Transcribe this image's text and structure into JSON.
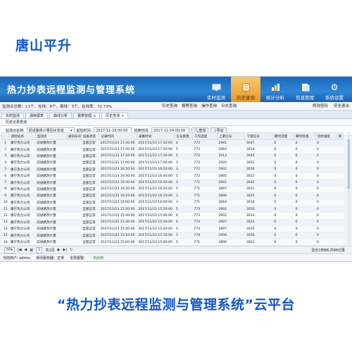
{
  "brand": "唐山平升",
  "caption": "“热力抄表远程监测与管理系统”云平台",
  "app": {
    "title": "热力抄表远程监测与管理系统",
    "nav": [
      {
        "label": "实时监测",
        "icon": "monitor-icon"
      },
      {
        "label": "历史查询",
        "icon": "history-icon"
      },
      {
        "label": "统计分析",
        "icon": "chart-icon"
      },
      {
        "label": "信息管理",
        "icon": "document-icon"
      },
      {
        "label": "系统设置",
        "icon": "gear-icon"
      }
    ]
  },
  "status": {
    "summary": "监测点总数：11个，在线：8个，离线：3个，在线率：72.73%",
    "sub_actions": [
      "历史查询",
      "报警查询",
      "操作查询",
      "日志查询"
    ],
    "right_actions": [
      "修改密码",
      "安全退出"
    ]
  },
  "tabs": [
    "实时监测",
    "通用报表",
    "曲线分析",
    "报表管理",
    "历史查询"
  ],
  "panel_title": "历史记录查询",
  "query": {
    "point_label": "监测点名称:",
    "point_value": "前进路热计量回水管道",
    "start_label": "起始时间:",
    "start_value": "2017-11-23 00:00",
    "end_label": "结束时间:",
    "end_value": "2017-11-24 00:00",
    "search_label": "查询",
    "export_label": "导出"
  },
  "table": {
    "headers": [
      "",
      "测控站点",
      "监测点",
      "通讯员ID",
      "设备状态",
      "记录时间",
      "采集时间",
      "信号质量",
      "工作温度",
      "上游信号",
      "下游信号",
      "瞬时流量",
      "瞬时热量",
      "流体速度",
      "累"
    ],
    "rows": [
      [
        "1",
        "康宁热力公司",
        "前进路热计量",
        "全部正常",
        "2017/11/23 17:30:00",
        "2017/11/23 17:30:00",
        "4",
        "772",
        "2941",
        "3047",
        "0",
        "0",
        "0"
      ],
      [
        "2",
        "康宁热力公司",
        "前进路热计量",
        "全部正常",
        "2017/11/23 17:20:00",
        "2017/11/23 17:20:00",
        "5",
        "773",
        "2983",
        "3024",
        "0",
        "0",
        "0"
      ],
      [
        "3",
        "康宁热力公司",
        "前进路热计量",
        "全部正常",
        "2017/11/23 17:10:00",
        "2017/11/23 17:10:00",
        "5",
        "772",
        "2912",
        "3044",
        "0",
        "0",
        "0"
      ],
      [
        "4",
        "康宁热力公司",
        "前进路热计量",
        "全部正常",
        "2017/11/23 17:00:00",
        "2017/11/23 17:00:00",
        "3",
        "773",
        "2920",
        "3052",
        "0",
        "0",
        "0"
      ],
      [
        "5",
        "康宁热力公司",
        "前进路热计量",
        "全部正常",
        "2017/11/23 16:50:00",
        "2017/11/23 16:50:00",
        "3",
        "772",
        "2902",
        "3026",
        "0",
        "0",
        "0"
      ],
      [
        "6",
        "康宁热力公司",
        "前进路热计量",
        "全部正常",
        "2017/11/23 16:40:00",
        "2017/11/23 16:40:00",
        "5",
        "773",
        "2885",
        "3022",
        "0",
        "0",
        "0"
      ],
      [
        "7",
        "康宁热力公司",
        "前进路热计量",
        "全部正常",
        "2017/11/23 16:30:00",
        "2017/11/23 16:30:00",
        "3",
        "771",
        "2901",
        "3042",
        "0",
        "0",
        "0"
      ],
      [
        "8",
        "康宁热力公司",
        "前进路热计量",
        "全部正常",
        "2017/11/23 16:20:00",
        "2017/11/23 16:20:00",
        "5",
        "771",
        "2897",
        "3031",
        "0",
        "0",
        "0"
      ],
      [
        "9",
        "康宁热力公司",
        "前进路热计量",
        "全部正常",
        "2017/11/23 16:10:00",
        "2017/11/23 16:10:00",
        "3",
        "771",
        "2896",
        "3022",
        "0",
        "0",
        "0"
      ],
      [
        "10",
        "康宁热力公司",
        "前进路热计量",
        "全部正常",
        "2017/11/23 16:00:00",
        "2017/11/23 16:00:00",
        "3",
        "771",
        "2818",
        "3034",
        "0",
        "0",
        "0"
      ],
      [
        "11",
        "康宁热力公司",
        "前进路热计量",
        "全部正常",
        "2017/11/23 15:50:00",
        "2017/11/23 15:50:00",
        "5",
        "773",
        "2892",
        "3050",
        "0",
        "0",
        "0"
      ],
      [
        "12",
        "康宁热力公司",
        "前进路热计量",
        "全部正常",
        "2017/11/23 15:40:00",
        "2017/11/23 15:40:00",
        "6",
        "773",
        "2902",
        "3033",
        "0",
        "0",
        "0"
      ],
      [
        "13",
        "康宁热力公司",
        "前进路热计量",
        "全部正常",
        "2017/11/23 15:30:00",
        "2017/11/23 15:30:00",
        "4",
        "774",
        "2907",
        "3023",
        "0",
        "0",
        "0"
      ],
      [
        "14",
        "康宁热力公司",
        "前进路热计量",
        "全部正常",
        "2017/11/23 15:20:00",
        "2017/11/23 15:20:00",
        "5",
        "773",
        "2897",
        "3035",
        "0",
        "0",
        "0"
      ],
      [
        "15",
        "康宁热力公司",
        "前进路热计量",
        "全部正常",
        "2017/11/23 15:10:00",
        "2017/11/23 15:10:00",
        "3",
        "774",
        "2906",
        "3030",
        "0",
        "0",
        "0"
      ],
      [
        "16",
        "康宁热力公司",
        "前进路热计量",
        "全部正常",
        "2017/11/23 15:00:00",
        "2017/11/23 15:00:00",
        "5",
        "771",
        "2898",
        "3022",
        "0",
        "0",
        "0"
      ]
    ]
  },
  "pager": {
    "page_size": "50",
    "page_prefix": "第",
    "page_num": "1",
    "page_suffix": "共1页",
    "info": "显示1到98,共98记录"
  },
  "footer": {
    "user": "当前用户: admin",
    "server": "通讯服务器：正常",
    "alarm_label": "全局报警：",
    "alarm_value": "未启用"
  }
}
